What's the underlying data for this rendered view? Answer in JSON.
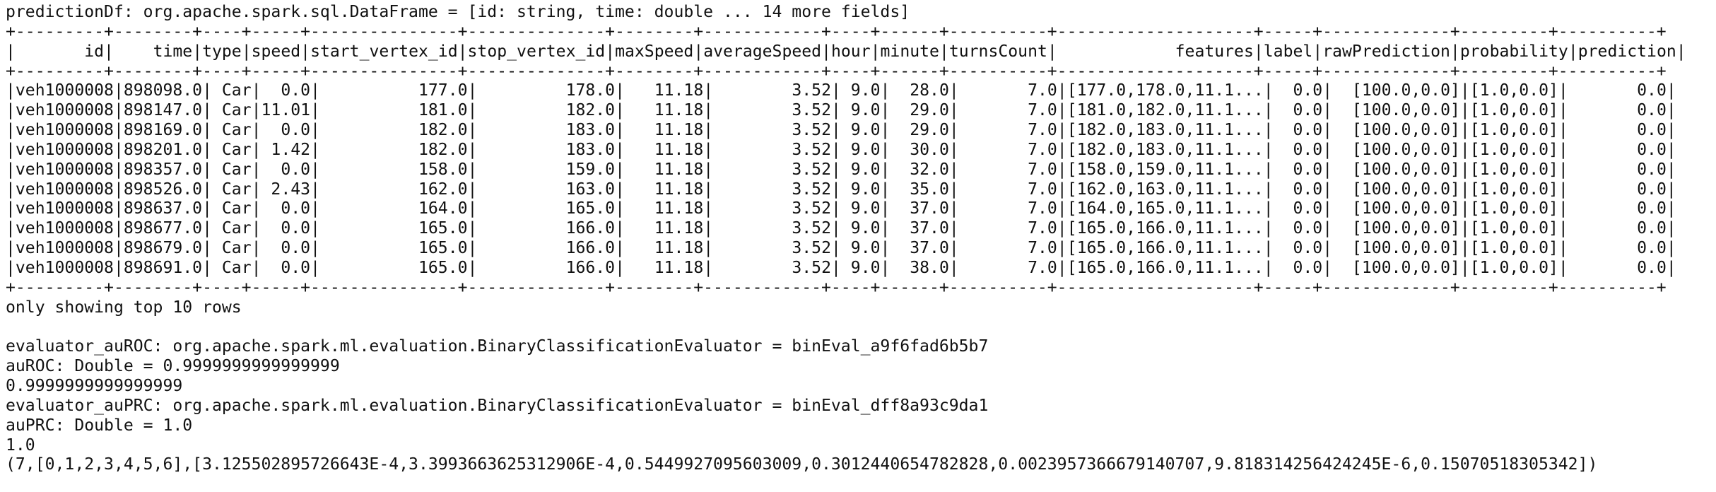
{
  "schema_line": "predictionDf: org.apache.spark.sql.DataFrame = [id: string, time: double ... 14 more fields]",
  "table": {
    "border_line": "+---------+--------+----+-----+---------------+--------------+--------+------------+----+------+----------+--------------------+-----+-------------+---------+----------+",
    "columns": [
      "id",
      "time",
      "type",
      "speed",
      "start_vertex_id",
      "stop_vertex_id",
      "maxSpeed",
      "averageSpeed",
      "hour",
      "minute",
      "turnsCount",
      "features",
      "label",
      "rawPrediction",
      "probability",
      "prediction"
    ],
    "rows": [
      [
        "veh1000008",
        "898098.0",
        "Car",
        "0.0",
        "177.0",
        "178.0",
        "11.18",
        "3.52",
        "9.0",
        "28.0",
        "7.0",
        "[177.0,178.0,11.1...",
        "0.0",
        "[100.0,0.0]",
        "[1.0,0.0]",
        "0.0"
      ],
      [
        "veh1000008",
        "898147.0",
        "Car",
        "11.01",
        "181.0",
        "182.0",
        "11.18",
        "3.52",
        "9.0",
        "29.0",
        "7.0",
        "[181.0,182.0,11.1...",
        "0.0",
        "[100.0,0.0]",
        "[1.0,0.0]",
        "0.0"
      ],
      [
        "veh1000008",
        "898169.0",
        "Car",
        "0.0",
        "182.0",
        "183.0",
        "11.18",
        "3.52",
        "9.0",
        "29.0",
        "7.0",
        "[182.0,183.0,11.1...",
        "0.0",
        "[100.0,0.0]",
        "[1.0,0.0]",
        "0.0"
      ],
      [
        "veh1000008",
        "898201.0",
        "Car",
        "1.42",
        "182.0",
        "183.0",
        "11.18",
        "3.52",
        "9.0",
        "30.0",
        "7.0",
        "[182.0,183.0,11.1...",
        "0.0",
        "[100.0,0.0]",
        "[1.0,0.0]",
        "0.0"
      ],
      [
        "veh1000008",
        "898357.0",
        "Car",
        "0.0",
        "158.0",
        "159.0",
        "11.18",
        "3.52",
        "9.0",
        "32.0",
        "7.0",
        "[158.0,159.0,11.1...",
        "0.0",
        "[100.0,0.0]",
        "[1.0,0.0]",
        "0.0"
      ],
      [
        "veh1000008",
        "898526.0",
        "Car",
        "2.43",
        "162.0",
        "163.0",
        "11.18",
        "3.52",
        "9.0",
        "35.0",
        "7.0",
        "[162.0,163.0,11.1...",
        "0.0",
        "[100.0,0.0]",
        "[1.0,0.0]",
        "0.0"
      ],
      [
        "veh1000008",
        "898637.0",
        "Car",
        "0.0",
        "164.0",
        "165.0",
        "11.18",
        "3.52",
        "9.0",
        "37.0",
        "7.0",
        "[164.0,165.0,11.1...",
        "0.0",
        "[100.0,0.0]",
        "[1.0,0.0]",
        "0.0"
      ],
      [
        "veh1000008",
        "898677.0",
        "Car",
        "0.0",
        "165.0",
        "166.0",
        "11.18",
        "3.52",
        "9.0",
        "37.0",
        "7.0",
        "[165.0,166.0,11.1...",
        "0.0",
        "[100.0,0.0]",
        "[1.0,0.0]",
        "0.0"
      ],
      [
        "veh1000008",
        "898679.0",
        "Car",
        "0.0",
        "165.0",
        "166.0",
        "11.18",
        "3.52",
        "9.0",
        "37.0",
        "7.0",
        "[165.0,166.0,11.1...",
        "0.0",
        "[100.0,0.0]",
        "[1.0,0.0]",
        "0.0"
      ],
      [
        "veh1000008",
        "898691.0",
        "Car",
        "0.0",
        "165.0",
        "166.0",
        "11.18",
        "3.52",
        "9.0",
        "38.0",
        "7.0",
        "[165.0,166.0,11.1...",
        "0.0",
        "[100.0,0.0]",
        "[1.0,0.0]",
        "0.0"
      ]
    ]
  },
  "footer_note": "only showing top 10 rows",
  "evaluation_lines": [
    "evaluator_auROC: org.apache.spark.ml.evaluation.BinaryClassificationEvaluator = binEval_a9f6fad6b5b7",
    "auROC: Double = 0.9999999999999999",
    "0.9999999999999999",
    "evaluator_auPRC: org.apache.spark.ml.evaluation.BinaryClassificationEvaluator = binEval_dff8a93c9da1",
    "auPRC: Double = 1.0",
    "1.0",
    "(7,[0,1,2,3,4,5,6],[3.125502895726643E-4,3.3993663625312906E-4,0.5449927095603009,0.3012440654782828,0.0023957366679140707,9.818314256424245E-6,0.15070518305342])"
  ]
}
